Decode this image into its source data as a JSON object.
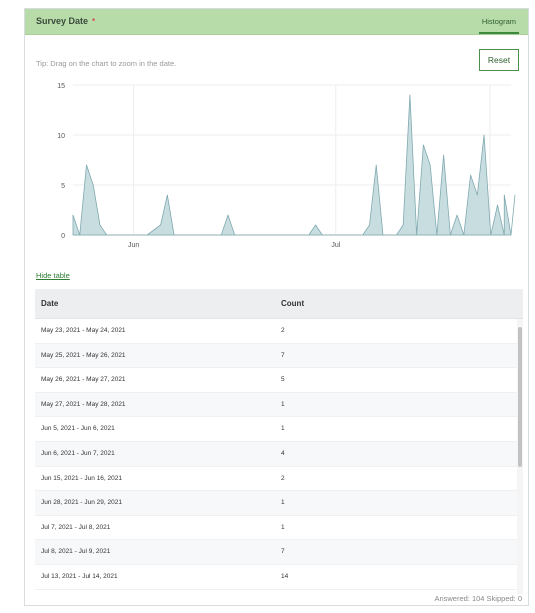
{
  "header": {
    "title": "Survey Date",
    "required_mark": "*",
    "tab_label": "Histogram"
  },
  "tip": "Tip: Drag on the chart to zoom in the date.",
  "reset_label": "Reset",
  "chart_data": {
    "type": "area",
    "y_ticks": [
      "0",
      "5",
      "10",
      "15"
    ],
    "ylim": [
      0,
      15
    ],
    "x_ticks": [
      {
        "label": "Jun",
        "x": "2021-06-01"
      },
      {
        "label": "Jul",
        "x": "2021-07-01"
      }
    ],
    "xlim": [
      "2021-05-23",
      "2021-07-27"
    ],
    "grid": true,
    "points": [
      {
        "x": "2021-05-23",
        "y": 2
      },
      {
        "x": "2021-05-24",
        "y": 0
      },
      {
        "x": "2021-05-25",
        "y": 7
      },
      {
        "x": "2021-05-26",
        "y": 5
      },
      {
        "x": "2021-05-27",
        "y": 1
      },
      {
        "x": "2021-05-28",
        "y": 0
      },
      {
        "x": "2021-06-03",
        "y": 0
      },
      {
        "x": "2021-06-05",
        "y": 1
      },
      {
        "x": "2021-06-06",
        "y": 4
      },
      {
        "x": "2021-06-07",
        "y": 0
      },
      {
        "x": "2021-06-14",
        "y": 0
      },
      {
        "x": "2021-06-15",
        "y": 2
      },
      {
        "x": "2021-06-16",
        "y": 0
      },
      {
        "x": "2021-06-27",
        "y": 0
      },
      {
        "x": "2021-06-28",
        "y": 1
      },
      {
        "x": "2021-06-29",
        "y": 0
      },
      {
        "x": "2021-07-05",
        "y": 0
      },
      {
        "x": "2021-07-06",
        "y": 1
      },
      {
        "x": "2021-07-07",
        "y": 7
      },
      {
        "x": "2021-07-08",
        "y": 0
      },
      {
        "x": "2021-07-10",
        "y": 0
      },
      {
        "x": "2021-07-11",
        "y": 1
      },
      {
        "x": "2021-07-12",
        "y": 14
      },
      {
        "x": "2021-07-13",
        "y": 0
      },
      {
        "x": "2021-07-14",
        "y": 9
      },
      {
        "x": "2021-07-15",
        "y": 7
      },
      {
        "x": "2021-07-16",
        "y": 0
      },
      {
        "x": "2021-07-17",
        "y": 8
      },
      {
        "x": "2021-07-18",
        "y": 0
      },
      {
        "x": "2021-07-19",
        "y": 2
      },
      {
        "x": "2021-07-20",
        "y": 0
      },
      {
        "x": "2021-07-21",
        "y": 6
      },
      {
        "x": "2021-07-22",
        "y": 4
      },
      {
        "x": "2021-07-23",
        "y": 10
      },
      {
        "x": "2021-07-24",
        "y": 0
      },
      {
        "x": "2021-07-25",
        "y": 3
      },
      {
        "x": "2021-07-26",
        "y": 0
      },
      {
        "x": "2021-07-26",
        "y": 4
      },
      {
        "x": "2021-07-27",
        "y": 0
      },
      {
        "x": "2021-07-27",
        "y": 4
      },
      {
        "x": "2021-07-27",
        "y": 0
      }
    ]
  },
  "hide_table_label": "Hide table",
  "table": {
    "columns": [
      "Date",
      "Count"
    ],
    "rows": [
      {
        "date": "May 23, 2021 - May 24, 2021",
        "count": "2"
      },
      {
        "date": "May 25, 2021 - May 26, 2021",
        "count": "7"
      },
      {
        "date": "May 26, 2021 - May 27, 2021",
        "count": "5"
      },
      {
        "date": "May 27, 2021 - May 28, 2021",
        "count": "1"
      },
      {
        "date": "Jun 5, 2021 - Jun 6, 2021",
        "count": "1"
      },
      {
        "date": "Jun 6, 2021 - Jun 7, 2021",
        "count": "4"
      },
      {
        "date": "Jun 15, 2021 - Jun 16, 2021",
        "count": "2"
      },
      {
        "date": "Jun 28, 2021 - Jun 29, 2021",
        "count": "1"
      },
      {
        "date": "Jul 7, 2021 - Jul 8, 2021",
        "count": "1"
      },
      {
        "date": "Jul 8, 2021 - Jul 9, 2021",
        "count": "7"
      },
      {
        "date": "Jul 13, 2021 - Jul 14, 2021",
        "count": "14"
      }
    ]
  },
  "footer": "Answered: 104  Skipped: 0",
  "colors": {
    "header_bg": "#b7dcaa",
    "area_fill": "#c8dde0",
    "area_stroke": "#7fa9b0",
    "accent": "#2e7d32"
  }
}
